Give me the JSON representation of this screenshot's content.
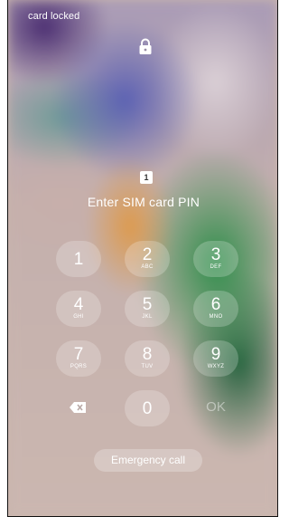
{
  "status_bar": {
    "text": "card locked"
  },
  "sim_icon_label": "1",
  "prompt": "Enter SIM card PIN",
  "keypad": [
    {
      "digit": "1",
      "letters": ""
    },
    {
      "digit": "2",
      "letters": "ABC"
    },
    {
      "digit": "3",
      "letters": "DEF"
    },
    {
      "digit": "4",
      "letters": "GHI"
    },
    {
      "digit": "5",
      "letters": "JKL"
    },
    {
      "digit": "6",
      "letters": "MNO"
    },
    {
      "digit": "7",
      "letters": "PQRS"
    },
    {
      "digit": "8",
      "letters": "TUV"
    },
    {
      "digit": "9",
      "letters": "WXYZ"
    },
    {
      "digit": "0",
      "letters": ""
    }
  ],
  "ok_label": "OK",
  "emergency_label": "Emergency call",
  "icons": {
    "lock": "lock-icon",
    "sim": "sim-card-icon",
    "backspace": "backspace-icon"
  }
}
